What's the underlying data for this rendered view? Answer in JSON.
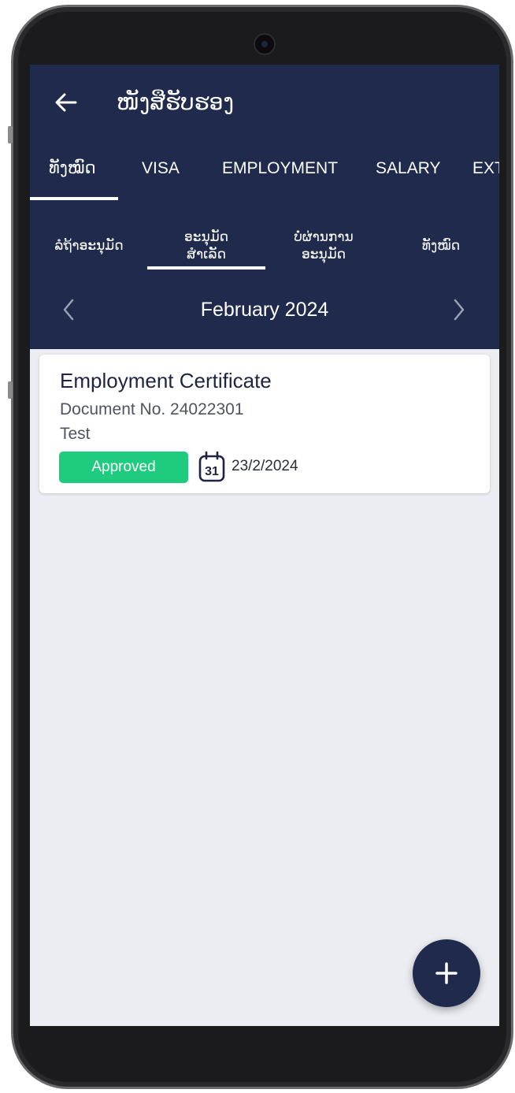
{
  "header": {
    "title": "ໜັງສືຮັບຮອງ",
    "back_icon": "arrow-left-icon"
  },
  "tabs": [
    {
      "label": "ທັງໝົດ",
      "active": true
    },
    {
      "label": "VISA",
      "active": false
    },
    {
      "label": "EMPLOYMENT",
      "active": false
    },
    {
      "label": "SALARY",
      "active": false
    },
    {
      "label": "EXT",
      "active": false
    }
  ],
  "subtabs": [
    {
      "line1": "ລໍຖ້າອະນຸມັດ",
      "line2": "",
      "active": false
    },
    {
      "line1": "ອະນຸມັດ",
      "line2": "ສໍາເລັດ",
      "active": true
    },
    {
      "line1": "ບໍ່ຜ່ານການ",
      "line2": "ອະນຸມັດ",
      "active": false
    },
    {
      "line1": "ທັງໝົດ",
      "line2": "",
      "active": false
    }
  ],
  "month_nav": {
    "label": "February 2024",
    "prev_icon": "chevron-left-icon",
    "next_icon": "chevron-right-icon"
  },
  "documents": [
    {
      "title": "Employment Certificate",
      "doc_no": "Document No. 24022301",
      "note": "Test",
      "status": "Approved",
      "date": "23/2/2024",
      "calendar_icon_day": "31"
    }
  ],
  "fab": {
    "icon": "plus-icon"
  },
  "colors": {
    "header_bg": "#1f2a4c",
    "screen_bg": "#ecedf2",
    "approved": "#1fcb7f",
    "fab_bg": "#1f2a4c"
  }
}
